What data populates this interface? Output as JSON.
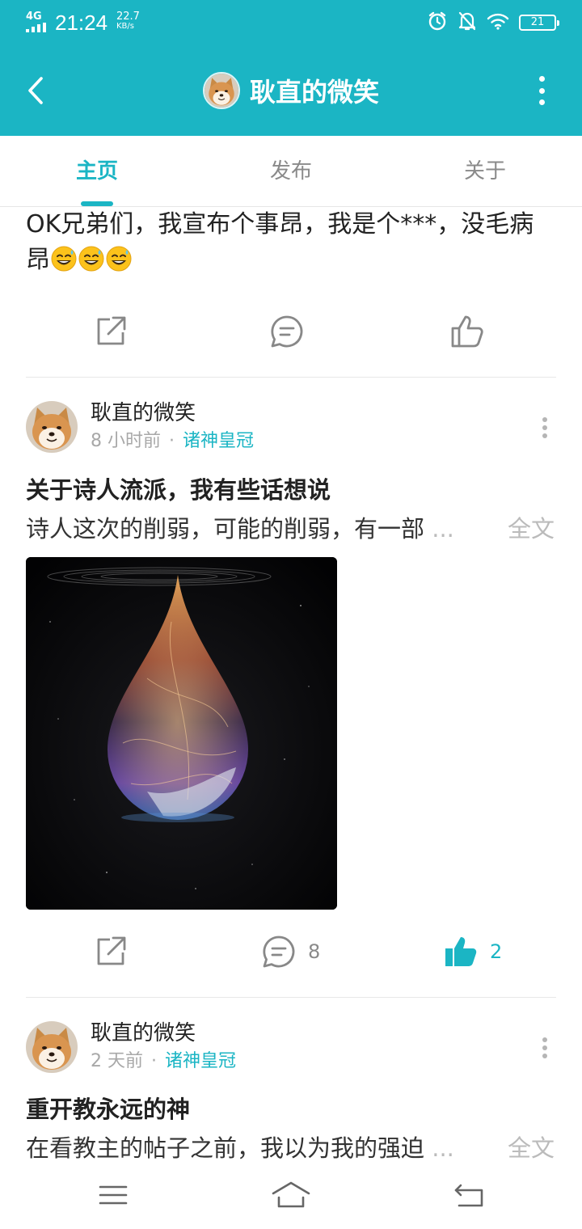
{
  "status_bar": {
    "network": "4G",
    "time": "21:24",
    "speed_value": "22.7",
    "speed_unit": "KB/s",
    "battery": "21",
    "icons": [
      "signal-icon",
      "alarm-icon",
      "mute-notification-icon",
      "wifi-icon",
      "battery-icon"
    ]
  },
  "app_bar": {
    "title": "耿直的微笑",
    "back_icon": "back-arrow-icon",
    "more_icon": "more-vertical-icon"
  },
  "tabs": [
    {
      "label": "主页",
      "active": true
    },
    {
      "label": "发布",
      "active": false
    },
    {
      "label": "关于",
      "active": false
    }
  ],
  "posts": [
    {
      "text": "OK兄弟们，我宣布个事昂，我是个***，没毛病昂",
      "emojis": [
        "sweat-smile-emoji",
        "sweat-smile-emoji",
        "sweat-smile-emoji"
      ],
      "actions": {
        "share_icon": "share-icon",
        "comment_icon": "comment-icon",
        "like_icon": "thumbs-up-icon"
      }
    },
    {
      "author": "耿直的微笑",
      "time": "8 小时前",
      "separator": "·",
      "circle": "诸神皇冠",
      "title": "关于诗人流派，我有些话想说",
      "excerpt": "诗人这次的削弱，可能的削弱，有一部",
      "ellipsis": "...",
      "full_text_label": "全文",
      "image": "cosmic-teardrop-image",
      "comments": "8",
      "likes": "2",
      "liked": true
    },
    {
      "author": "耿直的微笑",
      "time": "2 天前",
      "separator": "·",
      "circle": "诸神皇冠",
      "title": "重开教永远的神",
      "excerpt": "在看教主的帖子之前，我以为我的强迫",
      "ellipsis": "...",
      "full_text_label": "全文"
    }
  ],
  "nav_bar": {
    "menu_icon": "menu-icon",
    "home_icon": "home-icon",
    "back_icon": "return-icon"
  },
  "colors": {
    "accent": "#1bb5c4",
    "text": "#222222",
    "muted": "#a8a8a8"
  }
}
